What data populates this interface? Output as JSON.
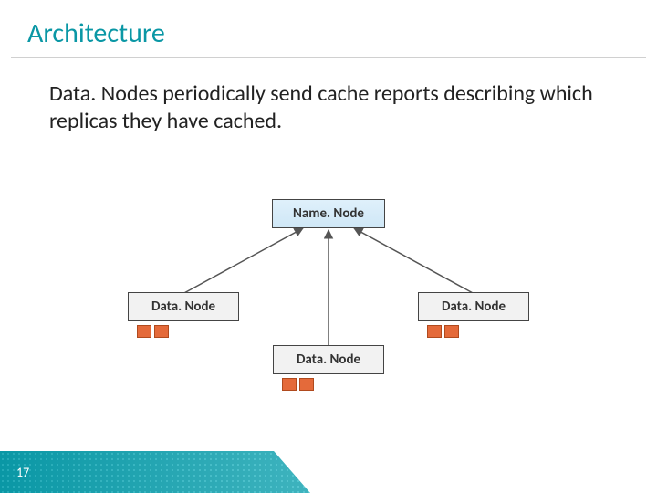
{
  "title": "Architecture",
  "body": "Data. Nodes periodically send cache reports describing which replicas they have cached.",
  "diagram": {
    "namenode": "Name. Node",
    "datanode_left": "Data. Node",
    "datanode_mid": "Data. Node",
    "datanode_right": "Data. Node"
  },
  "page_number": "17",
  "colors": {
    "accent": "#0a97a5",
    "block": "#e46a3a"
  }
}
